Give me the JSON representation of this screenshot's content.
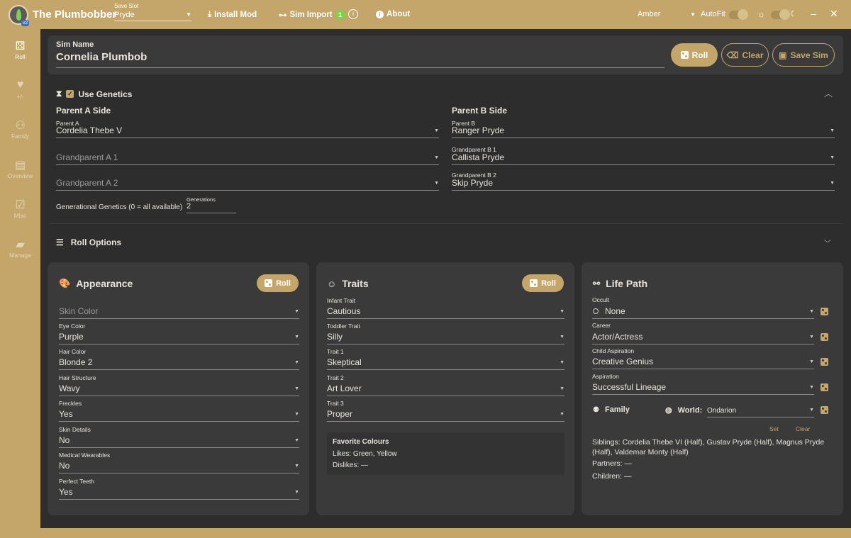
{
  "app": {
    "title": "The Plumbobber",
    "version_badge": "v2"
  },
  "topbar": {
    "save_slot_label": "Save Slot",
    "save_slot_value": "Pryde",
    "install_mod": "Install Mod",
    "sim_import": "Sim Import",
    "sim_import_count": "1",
    "about": "About",
    "theme_value": "Amber",
    "autofit": "AutoFit",
    "minimize": "–",
    "maximize": "☐",
    "close": "✕"
  },
  "sidebar": {
    "items": [
      {
        "label": "Roll",
        "icon": "dice-icon"
      },
      {
        "label": "+/-",
        "icon": "heart-icon"
      },
      {
        "label": "Family",
        "icon": "family-tree-icon"
      },
      {
        "label": "Overview",
        "icon": "id-card-icon"
      },
      {
        "label": "Misc",
        "icon": "calendar-check-icon"
      },
      {
        "label": "Manage",
        "icon": "folder-user-icon"
      }
    ]
  },
  "sim_name": {
    "label": "Sim Name",
    "value": "Cornelia Plumbob"
  },
  "actions": {
    "roll": "Roll",
    "clear": "Clear",
    "save_sim": "Save Sim"
  },
  "genetics": {
    "use_genetics": "Use Genetics",
    "parent_a_side": "Parent A Side",
    "parent_b_side": "Parent B Side",
    "parent_a_label": "Parent A",
    "parent_a_value": "Cordelia Thebe V",
    "grandparent_a1_placeholder": "Grandparent A 1",
    "grandparent_a2_placeholder": "Grandparent A 2",
    "parent_b_label": "Parent B",
    "parent_b_value": "Ranger Pryde",
    "grandparent_b1_label": "Grandparent B 1",
    "grandparent_b1_value": "Callista Pryde",
    "grandparent_b2_label": "Grandparent B 2",
    "grandparent_b2_value": "Skip Pryde",
    "generational_label": "Generational Genetics (0 = all available)",
    "generations_label": "Generations",
    "generations_value": "2"
  },
  "roll_options": {
    "label": "Roll Options"
  },
  "appearance": {
    "title": "Appearance",
    "roll": "Roll",
    "fields": [
      {
        "label": "",
        "value": "Skin Color",
        "placeholder": true
      },
      {
        "label": "Eye Color",
        "value": "Purple"
      },
      {
        "label": "Hair Color",
        "value": "Blonde 2"
      },
      {
        "label": "Hair Structure",
        "value": "Wavy"
      },
      {
        "label": "Freckles",
        "value": "Yes"
      },
      {
        "label": "Skin Details",
        "value": "No"
      },
      {
        "label": "Medical Wearables",
        "value": "No"
      },
      {
        "label": "Perfect Teeth",
        "value": "Yes"
      }
    ]
  },
  "traits": {
    "title": "Traits",
    "roll": "Roll",
    "fields": [
      {
        "label": "Infant Trait",
        "value": "Cautious"
      },
      {
        "label": "Toddler Trait",
        "value": "Silly"
      },
      {
        "label": "Trait 1",
        "value": "Skeptical"
      },
      {
        "label": "Trait 2",
        "value": "Art Lover"
      },
      {
        "label": "Trait 3",
        "value": "Proper"
      }
    ],
    "favorite_colours": {
      "title": "Favorite Colours",
      "likes": "Likes: Green, Yellow",
      "dislikes": "Dislikes: —"
    }
  },
  "life_path": {
    "title": "Life Path",
    "fields": [
      {
        "label": "Occult",
        "value": "None"
      },
      {
        "label": "Career",
        "value": "Actor/Actress"
      },
      {
        "label": "Child Aspiration",
        "value": "Creative Genius"
      },
      {
        "label": "Aspiration",
        "value": "Successful Lineage"
      }
    ],
    "family_label": "Family",
    "world_label": "World:",
    "world_value": "Ondarion",
    "set": "Set",
    "clear": "Clear",
    "siblings": "Siblings: Cordelia Thebe VI (Half), Gustav Pryde (Half), Magnus Pryde (Half), Valdemar Monty (Half)",
    "partners": "Partners: —",
    "children": "Children: —"
  },
  "colors": {
    "accent": "#c4a66a",
    "background": "#2d2d2d",
    "card": "#3a3a3a",
    "badge": "#7fd14a"
  }
}
